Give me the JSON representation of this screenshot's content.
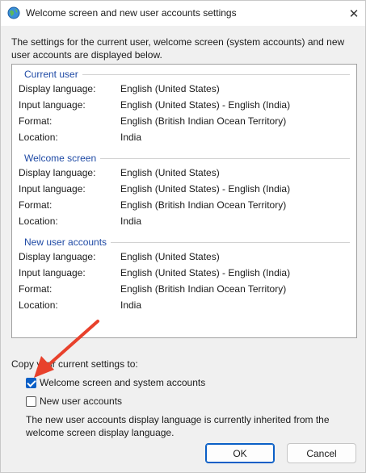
{
  "window": {
    "title": "Welcome screen and new user accounts settings",
    "close_icon": "close-icon",
    "app_icon": "globe-icon"
  },
  "intro": "The settings for the current user, welcome screen (system accounts) and new user accounts are displayed below.",
  "groups": [
    {
      "title": "Current user",
      "rows": [
        {
          "label": "Display language:",
          "value": "English (United States)"
        },
        {
          "label": "Input language:",
          "value": "English (United States) - English (India)"
        },
        {
          "label": "Format:",
          "value": "English (British Indian Ocean Territory)"
        },
        {
          "label": "Location:",
          "value": "India"
        }
      ]
    },
    {
      "title": "Welcome screen",
      "rows": [
        {
          "label": "Display language:",
          "value": "English (United States)"
        },
        {
          "label": "Input language:",
          "value": "English (United States) - English (India)"
        },
        {
          "label": "Format:",
          "value": "English (British Indian Ocean Territory)"
        },
        {
          "label": "Location:",
          "value": "India"
        }
      ]
    },
    {
      "title": "New user accounts",
      "rows": [
        {
          "label": "Display language:",
          "value": "English (United States)"
        },
        {
          "label": "Input language:",
          "value": "English (United States) - English (India)"
        },
        {
          "label": "Format:",
          "value": "English (British Indian Ocean Territory)"
        },
        {
          "label": "Location:",
          "value": "India"
        }
      ]
    }
  ],
  "copy_label": "Copy your current settings to:",
  "checkboxes": [
    {
      "label": "Welcome screen and system accounts",
      "checked": true
    },
    {
      "label": "New user accounts",
      "checked": false
    }
  ],
  "note": "The new user accounts display language is currently inherited from the welcome screen display language.",
  "buttons": {
    "ok": "OK",
    "cancel": "Cancel"
  },
  "colors": {
    "accent": "#0a5fc6",
    "group_title": "#1f4aa5",
    "annotation_arrow": "#e8412c"
  }
}
